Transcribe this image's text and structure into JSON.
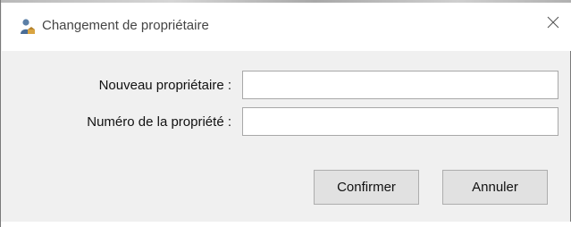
{
  "window": {
    "title": "Changement de propriétaire",
    "icon": "user-icon",
    "close_icon": "close-icon"
  },
  "form": {
    "owner_label": "Nouveau propriétaire :",
    "owner_value": "",
    "property_label": "Numéro de la propriété :",
    "property_value": ""
  },
  "buttons": {
    "confirm_label": "Confirmer",
    "cancel_label": "Annuler"
  },
  "colors": {
    "dialog_background": "#f0f0f0",
    "titlebar_background": "#ffffff",
    "button_face": "#e1e1e1",
    "field_border": "#a8a8a8"
  }
}
